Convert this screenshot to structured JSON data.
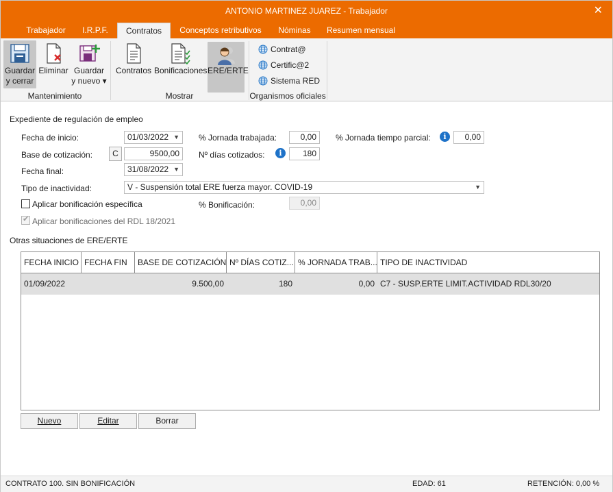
{
  "window": {
    "title": "ANTONIO MARTINEZ JUAREZ - Trabajador",
    "close_glyph": "✕"
  },
  "tabs": [
    {
      "label": "Trabajador"
    },
    {
      "label": "I.R.P.F."
    },
    {
      "label": "Contratos"
    },
    {
      "label": "Conceptos retributivos"
    },
    {
      "label": "Nóminas"
    },
    {
      "label": "Resumen mensual"
    }
  ],
  "ribbon": {
    "guardar_cerrar_l1": "Guardar",
    "guardar_cerrar_l2": "y cerrar",
    "eliminar": "Eliminar",
    "guardar_nuevo_l1": "Guardar",
    "guardar_nuevo_l2": "y nuevo ▾",
    "contratos": "Contratos",
    "bonificaciones": "Bonificaciones",
    "ere_erte": "ERE/ERTE",
    "contrat": "Contrat@",
    "certific": "Certific@2",
    "sistema_red": "Sistema RED",
    "group_mantenimiento": "Mantenimiento",
    "group_mostrar": "Mostrar",
    "group_organismos": "Organismos oficiales"
  },
  "form": {
    "section_title": "Expediente de regulación de empleo",
    "fecha_inicio_label": "Fecha de inicio:",
    "fecha_inicio_value": "01/03/2022",
    "base_cotizacion_label": "Base de cotización:",
    "base_cotizacion_btn": "C",
    "base_cotizacion_value": "9500,00",
    "fecha_final_label": "Fecha final:",
    "fecha_final_value": "31/08/2022",
    "jornada_trabajada_label": "% Jornada trabajada:",
    "jornada_trabajada_value": "0,00",
    "dias_cotizados_label": "Nº días cotizados:",
    "dias_cotizados_value": "180",
    "jornada_parcial_label": "% Jornada tiempo parcial:",
    "jornada_parcial_value": "0,00",
    "tipo_inactividad_label": "Tipo de inactividad:",
    "tipo_inactividad_value": "V - Suspensión total ERE fuerza mayor. COVID-19",
    "aplicar_bonificacion_label": "Aplicar bonificación específica",
    "porc_bonificacion_label": "% Bonificación:",
    "porc_bonificacion_value": "0,00",
    "aplicar_rdl_label": "Aplicar bonificaciones del RDL 18/2021"
  },
  "other": {
    "section_title": "Otras situaciones de ERE/ERTE",
    "columns": [
      "FECHA INICIO",
      "FECHA FIN",
      "BASE DE COTIZACIÓN",
      "Nº DÍAS COTIZ...",
      "% JORNADA TRAB...",
      "TIPO DE INACTIVIDAD"
    ],
    "rows": [
      [
        "01/09/2022",
        "",
        "9.500,00",
        "180",
        "0,00",
        "C7 - SUSP.ERTE LIMIT.ACTIVIDAD RDL30/20"
      ]
    ],
    "buttons": {
      "nuevo": "Nuevo",
      "editar": "Editar",
      "borrar": "Borrar"
    }
  },
  "status": {
    "contrato": "CONTRATO 100.  SIN BONIFICACIÓN",
    "edad": "EDAD: 61",
    "retencion": "RETENCIÓN: 0,00 %"
  },
  "colors": {
    "accent": "#ec6b00",
    "info": "#1e72c8",
    "selected_row": "#e0e0e0"
  },
  "icons": [
    "close-icon",
    "save-close-icon",
    "delete-document-icon",
    "save-new-icon",
    "contracts-icon",
    "bonus-checklist-icon",
    "ere-erte-icon",
    "globe-icon",
    "dropdown-arrow-icon",
    "info-icon",
    "checkmark-icon"
  ]
}
